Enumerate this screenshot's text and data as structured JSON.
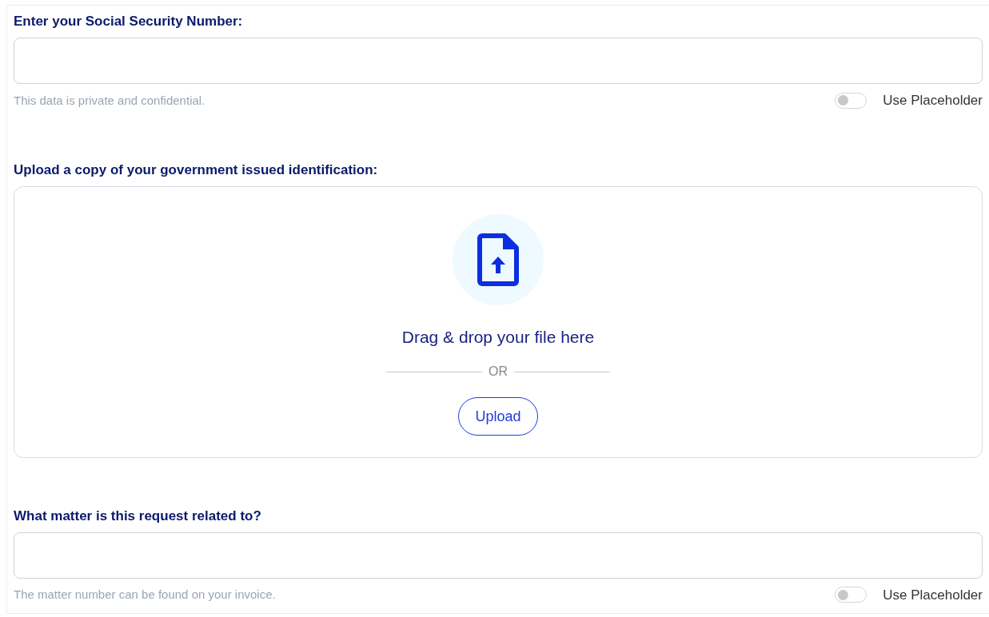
{
  "sections": [
    {
      "kind": "text",
      "label": "Enter your Social Security Number:",
      "hint": "This data is private and confidential.",
      "toggle": {
        "label": "Use Placeholder",
        "on": false
      }
    },
    {
      "kind": "upload",
      "label": "Upload a copy of your government issued identification:",
      "prompt": "Drag & drop your file here",
      "separator": "OR",
      "button": "Upload"
    },
    {
      "kind": "text",
      "label": "What matter is this request related to?",
      "hint": "The matter number can be found on your invoice.",
      "toggle": {
        "label": "Use Placeholder",
        "on": false
      }
    }
  ]
}
